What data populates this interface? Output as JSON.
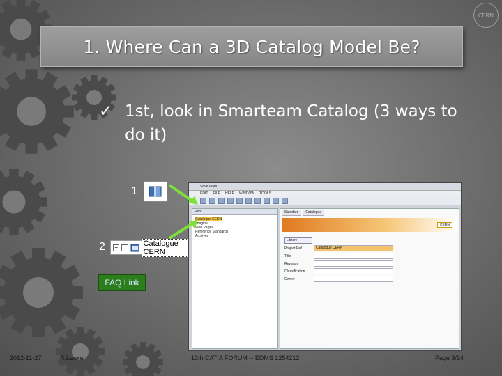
{
  "slide": {
    "title": "1.  Where Can a 3D Catalog Model Be?",
    "bullet_mark": "✓",
    "bullet_text": "1st, look in Smarteam Catalog (3 ways to do it)",
    "logo_text": "CERN",
    "label_1": "1",
    "label_2": "2",
    "catalogue_label": "Catalogue CERN",
    "faq_link": "FAQ Link"
  },
  "app": {
    "menu": [
      "EDIT",
      "FILE",
      "HELP",
      "WINDOW",
      "TOOLS"
    ],
    "tree_header": "Root",
    "tree_items": [
      "Catalogue CERN",
      "Imagine",
      "Web Pages",
      "Reference Standards",
      "Archives"
    ],
    "tabs": [
      "Standard",
      "Catalogue"
    ],
    "banner_label": "CERN",
    "form_tab": "Library",
    "form_rows": [
      {
        "label": "Project Ref",
        "value": "Catalogue CERN"
      },
      {
        "label": "Title",
        "value": ""
      },
      {
        "label": "Revision",
        "value": ""
      },
      {
        "label": "Classification",
        "value": ""
      },
      {
        "label": "Owner",
        "value": ""
      }
    ]
  },
  "footer": {
    "date": "2012-11-27",
    "author": "R.Leuxe",
    "center": "13th CATIA FORUM -- EDMS 1254212",
    "page": "Page 3/24"
  },
  "colors": {
    "faq_bg": "#2e7d1c",
    "arrow": "#7ee03a",
    "highlight": "#f4c542"
  }
}
